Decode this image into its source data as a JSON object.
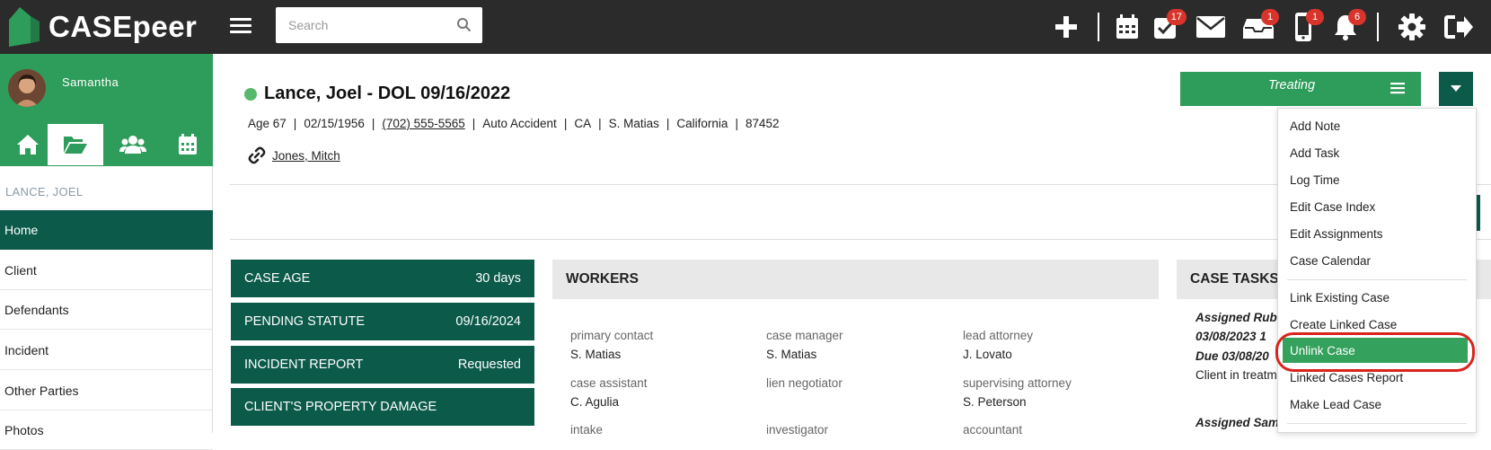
{
  "app": {
    "name": "CASEpeer"
  },
  "search": {
    "placeholder": "Search"
  },
  "topbar": {
    "badges": {
      "tasks": "17",
      "inbox": "1",
      "phone": "1",
      "notifications": "6"
    }
  },
  "user": {
    "name": "Samantha"
  },
  "sidebar": {
    "case_name": "LANCE, JOEL",
    "items": [
      "Home",
      "Client",
      "Defendants",
      "Incident",
      "Other Parties",
      "Photos"
    ]
  },
  "case": {
    "title": "Lance, Joel - DOL 09/16/2022",
    "age": "Age 67",
    "dob": "02/15/1956",
    "phone": "(702) 555-5565",
    "type": "Auto Accident",
    "state_code": "CA",
    "assignee": "S. Matias",
    "state": "California",
    "zip": "87452",
    "linked_contact": "Jones, Mitch"
  },
  "status_button": {
    "label": "Treating"
  },
  "stats": [
    {
      "label": "CASE AGE",
      "value": "30 days"
    },
    {
      "label": "PENDING STATUTE",
      "value": "09/16/2024"
    },
    {
      "label": "INCIDENT REPORT",
      "value": "Requested"
    },
    {
      "label": "CLIENT'S PROPERTY DAMAGE",
      "value": ""
    }
  ],
  "workers": {
    "title": "WORKERS",
    "fields": [
      {
        "label": "primary contact",
        "value": "S. Matias"
      },
      {
        "label": "case manager",
        "value": "S. Matias"
      },
      {
        "label": "lead attorney",
        "value": "J. Lovato"
      },
      {
        "label": "case assistant",
        "value": "C. Agulia"
      },
      {
        "label": "lien negotiator",
        "value": ""
      },
      {
        "label": "supervising attorney",
        "value": "S. Peterson"
      },
      {
        "label": "intake",
        "value": ""
      },
      {
        "label": "investigator",
        "value": ""
      },
      {
        "label": "accountant",
        "value": ""
      }
    ]
  },
  "tasks": {
    "title": "CASE TASKS",
    "line1": "Assigned Rub",
    "line2": "03/08/2023 1",
    "line3": "Due 03/08/20",
    "line4": "Client in treatm",
    "line5": "Assigned Sam"
  },
  "dropdown": {
    "items": [
      "Add Note",
      "Add Task",
      "Log Time",
      "Edit Case Index",
      "Edit Assignments",
      "Case Calendar",
      "Link Existing Case",
      "Create Linked Case",
      "Unlink Case",
      "Linked Cases Report",
      "Make Lead Case"
    ],
    "highlighted": "Unlink Case"
  },
  "colors": {
    "topbar": "#2b2b2b",
    "brand_green": "#2e9c5a",
    "dark_teal": "#0b5a4a",
    "badge_red": "#d9342b",
    "highlight_ring": "#d9241d"
  },
  "icons": [
    "logo-icon",
    "hamburger-icon",
    "search-icon",
    "plus-icon",
    "calendar-icon",
    "tasks-check-icon",
    "mail-icon",
    "inbox-icon",
    "phone-icon",
    "bell-icon",
    "gear-icon",
    "logout-icon",
    "home-icon",
    "folder-icon",
    "users-icon",
    "calendar-tab-icon",
    "link-icon",
    "menu-lines-icon",
    "caret-down-icon"
  ]
}
